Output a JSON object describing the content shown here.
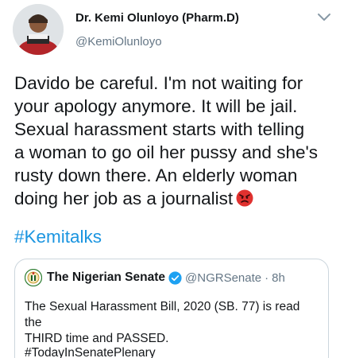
{
  "author": {
    "display_name": "Dr. Kemi Olunloyo (Pharm.D)",
    "handle": "@KemiOlunloyo"
  },
  "tweet": {
    "text": "Davido be careful. I'm not waiting for\nyour apology anymore. It will be jail.\nSexual harassment starts with telling\na woman to go oil her pussy and she's\nrusty down there. An elderly woman\ndoing her job as a journalist",
    "emoji": "angry-face-emoji",
    "hashtag": "#Kemitalks"
  },
  "quoted_tweet": {
    "display_name": "The Nigerian Senate",
    "handle": "@NGRSenate",
    "separator": "·",
    "time": "8h",
    "text": "The Sexual Harassment Bill, 2020 (SB. 77) is read the\nTHIRD time and PASSED.",
    "hashtag": "#TodayInSenatePlenary"
  },
  "colors": {
    "link": "#1b95e0",
    "secondary_text": "#657786",
    "verified": "#1da1f2",
    "border": "#ccd6dd"
  }
}
